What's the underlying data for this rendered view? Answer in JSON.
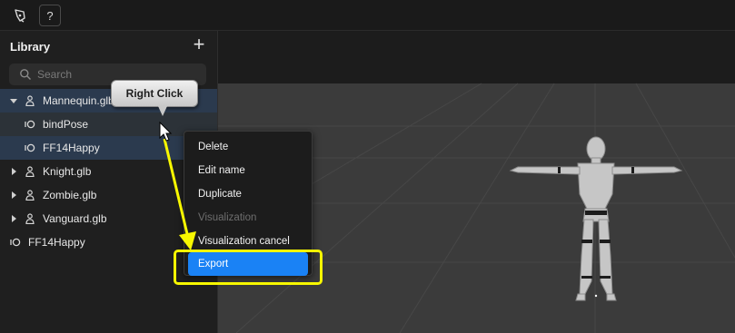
{
  "toolbar": {
    "logo_icon": "pen-tool-logo-icon",
    "help_label": "?"
  },
  "library": {
    "title": "Library",
    "add_label": "+",
    "search": {
      "placeholder": "Search",
      "value": ""
    },
    "items": [
      {
        "label": "Mannequin.glb",
        "kind": "model",
        "expanded": true
      },
      {
        "label": "bindPose",
        "kind": "animation",
        "child": true
      },
      {
        "label": "FF14Happy",
        "kind": "animation",
        "child": true
      },
      {
        "label": "Knight.glb",
        "kind": "model",
        "expanded": false
      },
      {
        "label": "Zombie.glb",
        "kind": "model",
        "expanded": false
      },
      {
        "label": "Vanguard.glb",
        "kind": "model",
        "expanded": false
      },
      {
        "label": "FF14Happy",
        "kind": "animation",
        "child": false
      }
    ]
  },
  "callout": {
    "text": "Right Click"
  },
  "context_menu": {
    "items": [
      {
        "label": "Delete",
        "enabled": true
      },
      {
        "label": "Edit name",
        "enabled": true
      },
      {
        "label": "Duplicate",
        "enabled": true
      },
      {
        "label": "Visualization",
        "enabled": false
      },
      {
        "label": "Visualization cancel",
        "enabled": true
      },
      {
        "label": "Export",
        "enabled": true,
        "highlighted": true
      }
    ]
  },
  "colors": {
    "accent": "#1a82f5",
    "annotation": "#f7f700",
    "selection": "#2b3a4e"
  }
}
